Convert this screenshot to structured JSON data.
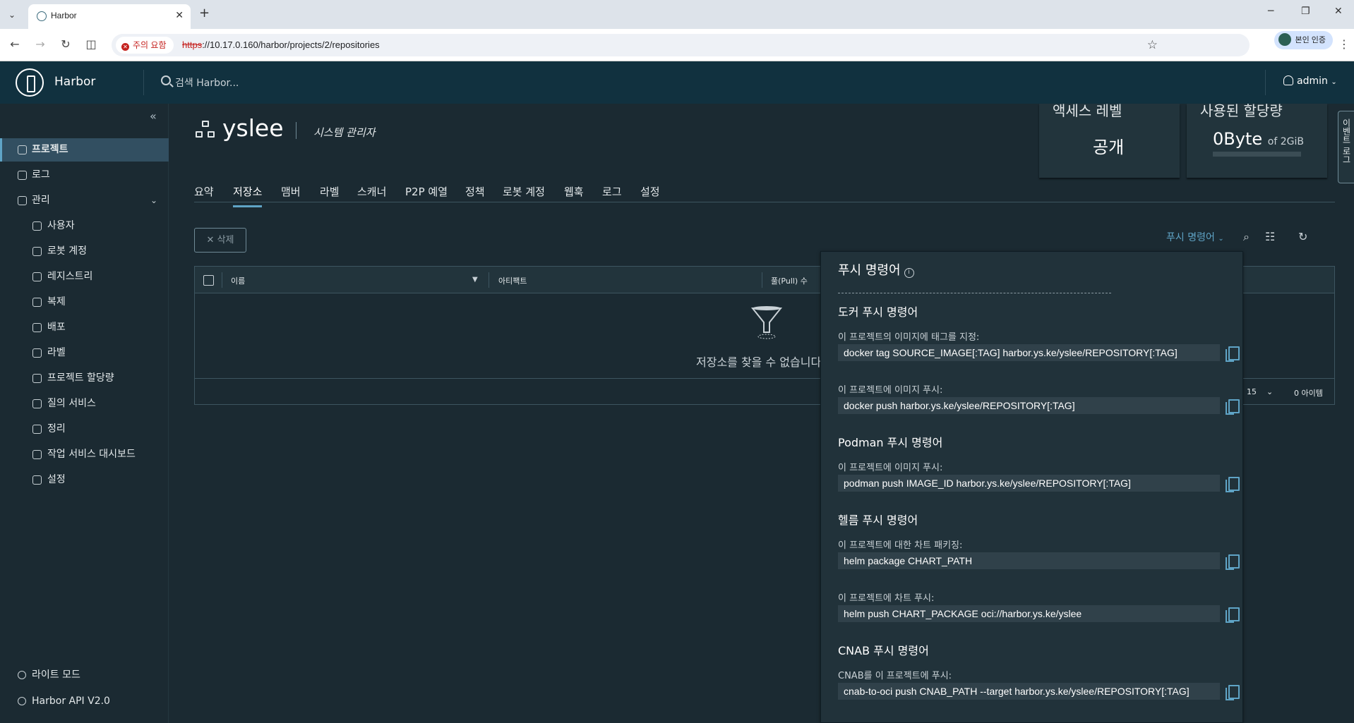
{
  "browser": {
    "tab_title": "Harbor",
    "tab_close": "✕",
    "new_tab": "+",
    "security_chip": "주의 요함",
    "url_scheme": "https",
    "url_rest": "://10.17.0.160/harbor/projects/2/repositories",
    "profile_label": "본인 인증"
  },
  "header": {
    "brand": "Harbor",
    "search_placeholder": "검색 Harbor...",
    "user": "admin"
  },
  "sidebar": {
    "items": [
      {
        "label": "프로젝트",
        "icon": "projects-icon",
        "active": true
      },
      {
        "label": "로그",
        "icon": "logs-icon"
      },
      {
        "label": "관리",
        "icon": "admin-icon"
      }
    ],
    "admin_items": [
      {
        "label": "사용자",
        "icon": "users-icon"
      },
      {
        "label": "로봇 계정",
        "icon": "robot-icon"
      },
      {
        "label": "레지스트리",
        "icon": "registry-icon"
      },
      {
        "label": "복제",
        "icon": "replication-icon"
      },
      {
        "label": "배포",
        "icon": "distribution-icon"
      },
      {
        "label": "라벨",
        "icon": "label-icon"
      },
      {
        "label": "프로젝트 할당량",
        "icon": "quota-icon"
      },
      {
        "label": "질의 서비스",
        "icon": "interrogation-icon"
      },
      {
        "label": "정리",
        "icon": "clean-icon"
      },
      {
        "label": "작업 서비스 대시보드",
        "icon": "dashboard-icon"
      },
      {
        "label": "설정",
        "icon": "gear-icon"
      }
    ],
    "light_mode": "라이트 모드",
    "api": "Harbor API V2.0"
  },
  "project": {
    "name": "yslee",
    "role": "시스템 관리자",
    "access_level_title": "액세스 레벨",
    "access_level_value": "공개",
    "quota_title": "사용된 할당량",
    "quota_used": "0Byte",
    "quota_of": "of 2GiB",
    "quota_used_fraction": 0
  },
  "tabs": [
    "요약",
    "저장소",
    "맴버",
    "라벨",
    "스캐너",
    "P2P 예열",
    "정책",
    "로봇 계정",
    "웹훅",
    "로그",
    "설정"
  ],
  "active_tab": "저장소",
  "toolbar": {
    "delete": "삭제",
    "push_command": "푸시 명령어"
  },
  "grid": {
    "columns": [
      "이름",
      "아티팩트",
      "풀(Pull) 수"
    ],
    "empty_text": "저장소를 찾을 수 없습니다",
    "page_size": "15",
    "item_count": "0 아이템"
  },
  "push_panel": {
    "title": "푸시 명령어",
    "sections": [
      {
        "title": "도커 푸시 명령어",
        "commands": [
          {
            "label": "이 프로젝트의 이미지에 태그를 지정:",
            "command": "docker tag SOURCE_IMAGE[:TAG] harbor.ys.ke/yslee/REPOSITORY[:TAG]"
          },
          {
            "label": "이 프로젝트에 이미지 푸시:",
            "command": "docker push harbor.ys.ke/yslee/REPOSITORY[:TAG]"
          }
        ]
      },
      {
        "title": "Podman 푸시 명령어",
        "commands": [
          {
            "label": "이 프로젝트에 이미지 푸시:",
            "command": "podman push IMAGE_ID harbor.ys.ke/yslee/REPOSITORY[:TAG]"
          }
        ]
      },
      {
        "title": "헬름 푸시 명령어",
        "commands": [
          {
            "label": "이 프로젝트에 대한 차트 패키징:",
            "command": "helm package CHART_PATH"
          },
          {
            "label": "이 프로젝트에 차트 푸시:",
            "command": "helm push CHART_PACKAGE oci://harbor.ys.ke/yslee"
          }
        ]
      },
      {
        "title": "CNAB 푸시 명령어",
        "commands": [
          {
            "label": "CNAB를 이 프로젝트에 푸시:",
            "command": "cnab-to-oci push CNAB_PATH --target harbor.ys.ke/yslee/REPOSITORY[:TAG]"
          }
        ]
      }
    ]
  },
  "event_tab": "이벤트 로그",
  "colors": {
    "header_bg": "#11313f",
    "body_bg": "#1b2a32",
    "accent": "#5fa4c6",
    "panel_bg": "#21323a",
    "warning": "#c5221f"
  }
}
